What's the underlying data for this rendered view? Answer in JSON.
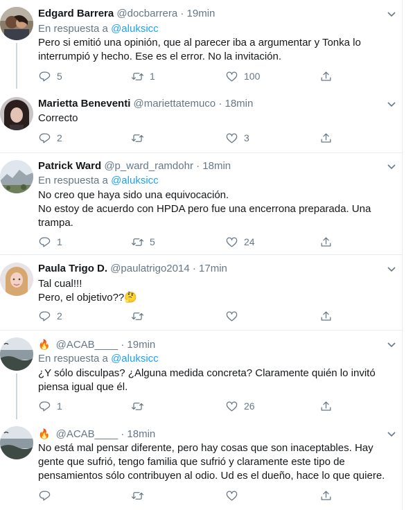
{
  "colors": {
    "text": "#14171a",
    "muted": "#657786",
    "link": "#1da1f2",
    "divider": "#e6ecf0",
    "thread": "#ccd6dd"
  },
  "icons": {
    "reply": "reply-icon",
    "retweet": "retweet-icon",
    "like": "like-icon",
    "share": "share-icon",
    "more": "chevron-down-icon",
    "fire": "fire-emoji"
  },
  "tweets": [
    {
      "name": "Edgard Barrera",
      "handle": "@docbarrera",
      "separator": "·",
      "time": "19min",
      "reply_prefix": "En respuesta a",
      "reply_to": "@aluksicc",
      "lines": [
        "Pero si emitió una opinión, que al parecer iba a argumentar y Tonka lo",
        "interrumpió y hecho. Ese es el error. No la invitación."
      ],
      "replies": "5",
      "retweets": "1",
      "likes": "100"
    },
    {
      "name": "Marietta Beneventi",
      "handle": "@mariettatemuco",
      "separator": "·",
      "time": "18min",
      "lines": [
        "Correcto"
      ],
      "replies": "2",
      "retweets": "",
      "likes": "3"
    },
    {
      "name": "Patrick Ward",
      "handle": "@p_ward_ramdohr",
      "separator": "·",
      "time": "18min",
      "reply_prefix": "En respuesta a",
      "reply_to": "@aluksicc",
      "lines": [
        "No creo que haya sido una equivocación.",
        "No estoy de acuerdo con HPDA pero fue una encerrona preparada. Una",
        "trampa."
      ],
      "replies": "1",
      "retweets": "5",
      "likes": "24"
    },
    {
      "name": "Paula Trigo D.",
      "handle": "@paulatrigo2014",
      "separator": "·",
      "time": "17min",
      "lines": [
        "Tal cual!!!",
        "Pero, el objetivo??🤔"
      ],
      "replies": "2",
      "retweets": "",
      "likes": ""
    },
    {
      "name": "🔥",
      "handle": "@ACAB____",
      "separator": "·",
      "time": "19min",
      "reply_prefix": "En respuesta a",
      "reply_to": "@aluksicc",
      "lines": [
        "¿Y sólo disculpas? ¿Alguna medida concreta? Claramente quién lo invitó",
        "piensa igual que él."
      ],
      "replies": "1",
      "retweets": "",
      "likes": "26"
    },
    {
      "name": "🔥",
      "handle": "@ACAB____",
      "separator": "·",
      "time": "18min",
      "lines": [
        "No está mal pensar diferente, pero hay cosas que son inaceptables. Hay",
        "gente que sufrió, tengo familia que sufrió y claramente este tipo de",
        "pensamientos sólo contribuyen al odio. Ud es el dueño, hace lo que quiere."
      ],
      "replies": "",
      "retweets": "",
      "likes": ""
    }
  ]
}
